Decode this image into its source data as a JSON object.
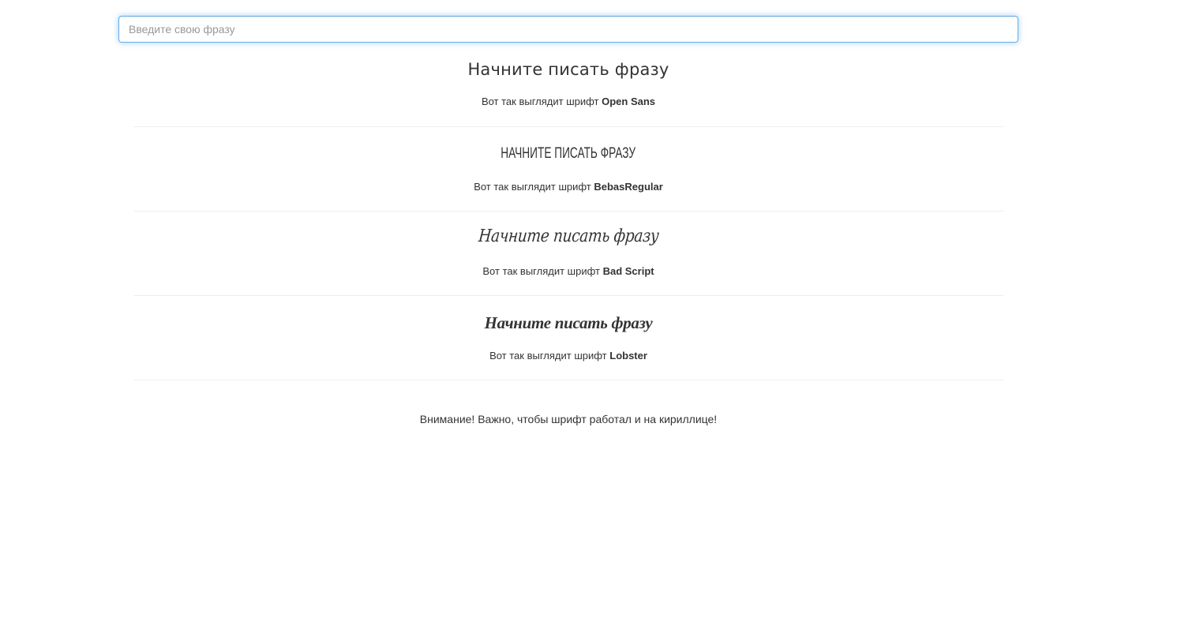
{
  "search": {
    "placeholder": "Введите свою фразу",
    "value": ""
  },
  "samples": [
    {
      "phrase": "Начните писать фразу",
      "caption_prefix": "Вот так выглядит шрифт",
      "font_name": "Open Sans"
    },
    {
      "phrase": "НАЧНИТЕ ПИСАТЬ ФРАЗУ",
      "caption_prefix": "Вот так выглядит шрифт",
      "font_name": "BebasRegular"
    },
    {
      "phrase": "Начните писать фразу",
      "caption_prefix": "Вот так выглядит шрифт",
      "font_name": "Bad Script"
    },
    {
      "phrase": "Начните писать фразу",
      "caption_prefix": "Вот так выглядит шрифт",
      "font_name": "Lobster"
    }
  ],
  "notice": "Внимание! Важно, чтобы шрифт работал и на кириллице!",
  "colors": {
    "text": "#333333",
    "input_focus_border": "#66afe9",
    "divider": "#eeeeee"
  }
}
